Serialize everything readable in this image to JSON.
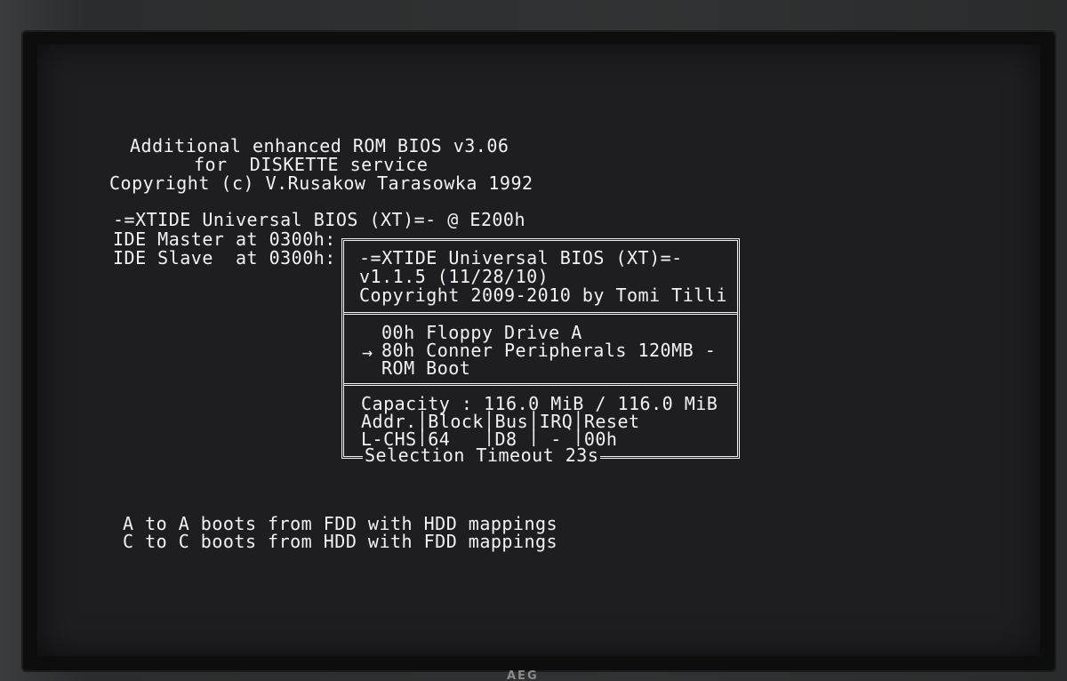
{
  "header": {
    "line1": "Additional enhanced ROM BIOS v3.06",
    "line2": "for  DISKETTE service",
    "line3": "Copyright (c) V.Rusakow Tarasowka 1992"
  },
  "xtide_line": "-=XTIDE Universal BIOS (XT)=- @ E200h",
  "ide": {
    "master": "IDE Master at 0300h:",
    "slave": "IDE Slave  at 0300h:"
  },
  "menu": {
    "title": "-=XTIDE Universal BIOS (XT)=-",
    "version": "v1.1.5 (11/28/10)",
    "copyright": "Copyright 2009-2010 by Tomi Tilli",
    "items": [
      {
        "label": "00h Floppy Drive A"
      },
      {
        "label": "80h Conner Peripherals 120MB -",
        "selected": true
      },
      {
        "label": "ROM Boot"
      }
    ],
    "selected_marker": "→",
    "capacity": "Capacity : 116.0 MiB / 116.0 MiB",
    "info_header": "Addr.│Block│Bus│IRQ│Reset",
    "info_values": "L-CHS│64   │D8 │ - │00h",
    "footer": "Selection Timeout 23s"
  },
  "notes": {
    "a": "A to A boots from FDD with HDD mappings",
    "c": "C to C boots from HDD with FDD mappings"
  },
  "monitor_brand": "AEG"
}
